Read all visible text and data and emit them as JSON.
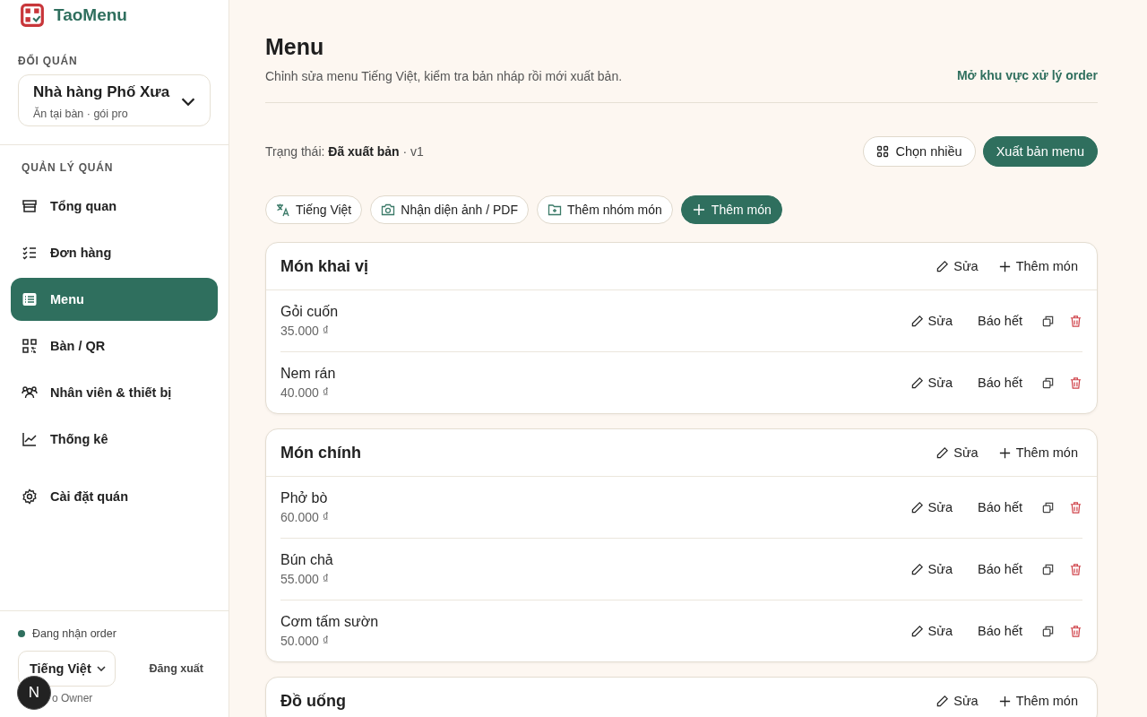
{
  "brand": {
    "name": "TaoMenu"
  },
  "sidebar": {
    "switch_label": "ĐỔI QUÁN",
    "restaurant": {
      "name": "Nhà hàng Phố Xưa",
      "subtitle": "Ăn tại bàn · gói pro"
    },
    "section_label": "QUẢN LÝ QUÁN",
    "nav": [
      {
        "label": "Tổng quan",
        "kind": "store",
        "selected": false
      },
      {
        "label": "Đơn hàng",
        "kind": "checklist",
        "selected": false
      },
      {
        "label": "Menu",
        "kind": "list",
        "selected": true
      },
      {
        "label": "Bàn / QR",
        "kind": "qr",
        "selected": false
      },
      {
        "label": "Nhân viên & thiết bị",
        "kind": "people",
        "selected": false
      },
      {
        "label": "Thống kê",
        "kind": "chart",
        "selected": false
      }
    ],
    "settings": {
      "label": "Cài đặt quán",
      "kind": "gear",
      "selected": false
    },
    "order_status": {
      "label": "Đang nhận order",
      "on": true
    },
    "language": "Tiếng Việt",
    "logout": "Đăng xuất",
    "user": "o Owner",
    "avatar": "N"
  },
  "header": {
    "title": "Menu",
    "subtitle": "Chỉnh sửa menu Tiếng Việt, kiểm tra bản nháp rồi mới xuất bản.",
    "link": "Mở khu vực xử lý order"
  },
  "status": {
    "text": "Trạng thái: **Đã xuất bản** · v1"
  },
  "buttons": [
    {
      "label": "Chọn nhiều",
      "kind": "outline"
    },
    {
      "label": "Xuất bản menu",
      "kind": "primary"
    }
  ],
  "chips": [
    {
      "label": "Tiếng Việt",
      "kind": "language"
    },
    {
      "label": "Nhận diện ảnh / PDF",
      "kind": "camera"
    },
    {
      "label": "Thêm nhóm món",
      "kind": "folder"
    },
    {
      "label": "Thêm món",
      "kind": "add"
    }
  ],
  "sections": [
    {
      "title": "Món khai vị",
      "edit": "Sửa",
      "add": "Thêm món",
      "items": [
        {
          "name": "Gỏi cuốn",
          "price": "35.000 ₫",
          "edit": "Sửa",
          "sold_out": "Báo hết"
        },
        {
          "name": "Nem rán",
          "price": "40.000 ₫",
          "edit": "Sửa",
          "sold_out": "Báo hết"
        }
      ]
    },
    {
      "title": "Món chính",
      "edit": "Sửa",
      "add": "Thêm món",
      "items": [
        {
          "name": "Phở bò",
          "price": "60.000 ₫",
          "edit": "Sửa",
          "sold_out": "Báo hết"
        },
        {
          "name": "Bún chả",
          "price": "55.000 ₫",
          "edit": "Sửa",
          "sold_out": "Báo hết"
        },
        {
          "name": "Cơm tấm sườn",
          "price": "50.000 ₫",
          "edit": "Sửa",
          "sold_out": "Báo hết"
        }
      ]
    },
    {
      "title": "Đồ uống",
      "edit": "Sửa",
      "add": "Thêm món"
    }
  ]
}
